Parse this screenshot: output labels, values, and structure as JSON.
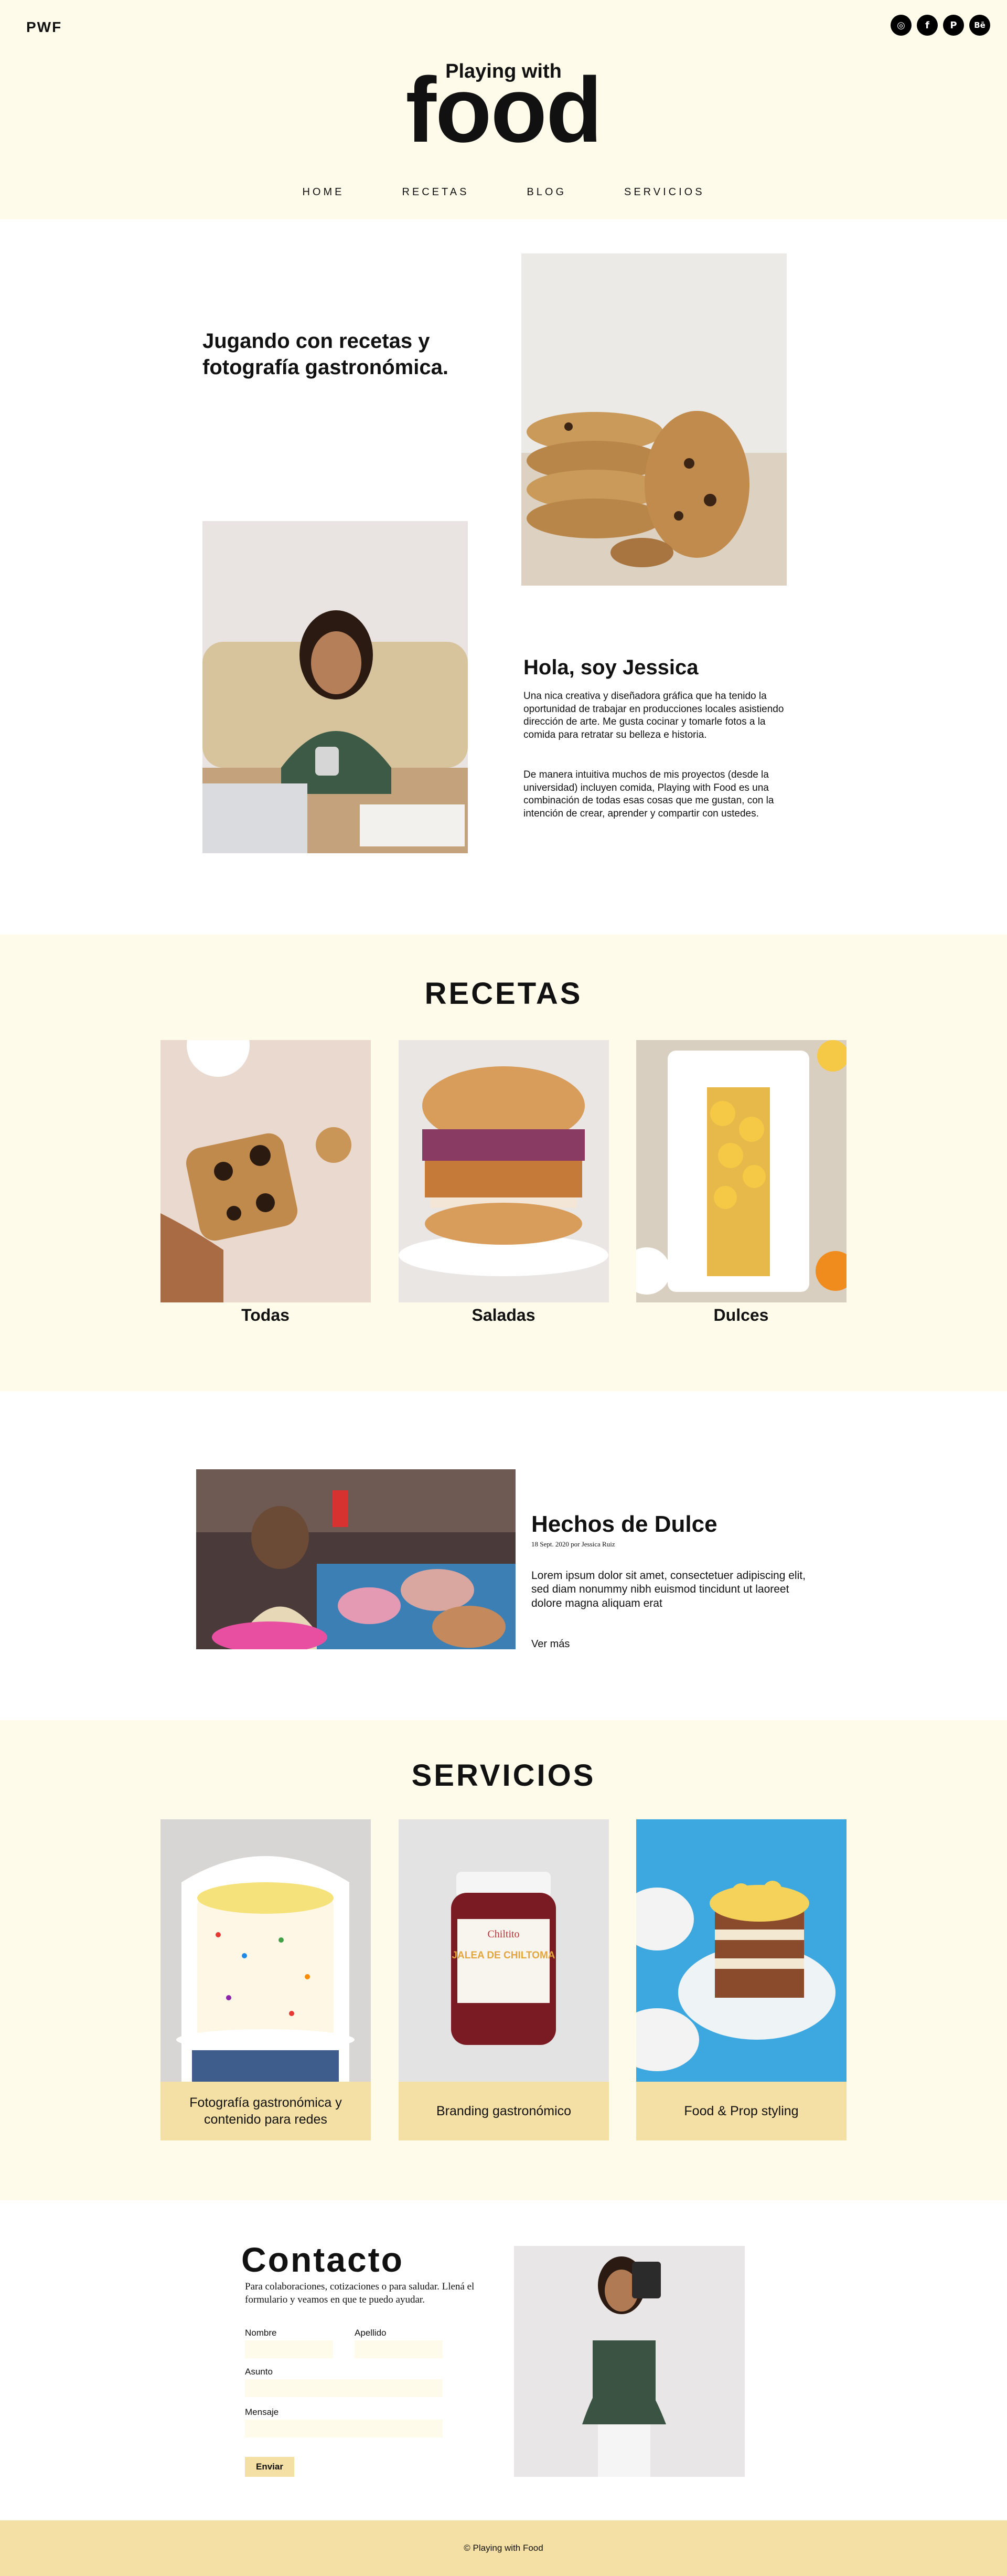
{
  "brand": {
    "short": "PWF",
    "logo_small": "Playing with",
    "logo_big": "food"
  },
  "socials": [
    {
      "icon": "instagram-icon",
      "glyph": "◎"
    },
    {
      "icon": "facebook-icon",
      "glyph": "f"
    },
    {
      "icon": "pinterest-icon",
      "glyph": "P"
    },
    {
      "icon": "behance-icon",
      "glyph": "Bē"
    }
  ],
  "nav": [
    "HOME",
    "RECETAS",
    "BLOG",
    "SERVICIOS"
  ],
  "hero": {
    "heading": "Jugando con recetas y fotografía gastronómica.",
    "about_title": "Hola, soy Jessica",
    "about_p1": "Una nica creativa y diseñadora gráfica que ha tenido la oportunidad de trabajar en producciones locales asistiendo dirección de arte.  Me gusta cocinar y tomarle fotos a la comida para retratar su belleza e historia.",
    "about_p2": "De manera intuitiva muchos de mis proyectos (desde la universidad) incluyen comida, Playing with Food es una combinación de todas esas cosas que me gustan, con la intención de crear, aprender y compartir con ustedes."
  },
  "recetas": {
    "title": "RECETAS",
    "cards": [
      "Todas",
      "Saladas",
      "Dulces"
    ]
  },
  "blog": {
    "title": "Hechos de Dulce",
    "meta": "18 Sept. 2020 por Jessica Ruiz",
    "excerpt": "Lorem ipsum dolor sit amet, consectetuer adipiscing elit, sed diam nonummy nibh euismod tincidunt ut laoreet dolore magna aliquam erat",
    "more": "Ver más"
  },
  "servicios": {
    "title": "SERVICIOS",
    "cards": [
      "Fotografía gastronómica y contenido para redes",
      "Branding gastronómico",
      "Food & Prop styling"
    ],
    "jar_brand": "Chiltito",
    "jar_label": "JALEA DE CHILTOMA"
  },
  "contacto": {
    "title": "Contacto",
    "intro": "Para colaboraciones, cotizaciones o para saludar. Llená el formulario y veamos en que te puedo ayudar.",
    "fields": {
      "nombre": "Nombre",
      "apellido": "Apellido",
      "asunto": "Asunto",
      "mensaje": "Mensaje"
    },
    "submit": "Enviar"
  },
  "footer": {
    "text": "© Playing with Food"
  },
  "colors": {
    "cream": "#fefbeb",
    "accent": "#f4dfa4",
    "text": "#111111"
  }
}
